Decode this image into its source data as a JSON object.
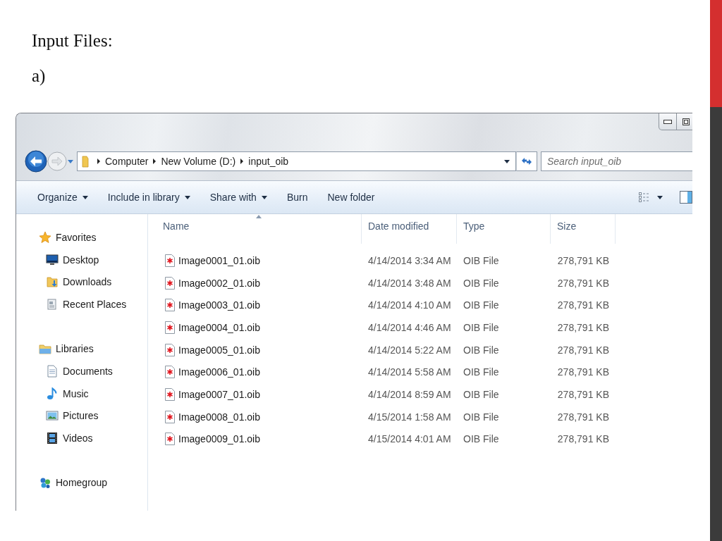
{
  "slide": {
    "heading": "Input Files:",
    "label": "a)"
  },
  "explorer": {
    "address_bar": {
      "breadcrumbs": [
        "Computer",
        "New Volume (D:)",
        "input_oib"
      ]
    },
    "search": {
      "placeholder": "Search input_oib"
    },
    "toolbar": {
      "items": [
        {
          "label": "Organize",
          "dropdown": true
        },
        {
          "label": "Include in library",
          "dropdown": true
        },
        {
          "label": "Share with",
          "dropdown": true
        },
        {
          "label": "Burn",
          "dropdown": false
        },
        {
          "label": "New folder",
          "dropdown": false
        }
      ]
    },
    "navigation": {
      "groups": [
        {
          "label": "Favorites",
          "kind": "star",
          "children": [
            {
              "label": "Desktop",
              "kind": "desktop"
            },
            {
              "label": "Downloads",
              "kind": "downloads"
            },
            {
              "label": "Recent Places",
              "kind": "recent"
            }
          ]
        },
        {
          "label": "Libraries",
          "kind": "library",
          "children": [
            {
              "label": "Documents",
              "kind": "documents"
            },
            {
              "label": "Music",
              "kind": "music"
            },
            {
              "label": "Pictures",
              "kind": "pictures"
            },
            {
              "label": "Videos",
              "kind": "videos"
            }
          ]
        },
        {
          "label": "Homegroup",
          "kind": "homegroup"
        }
      ]
    },
    "table": {
      "columns": [
        {
          "label": "Name",
          "sorted": true
        },
        {
          "label": "Date modified",
          "sorted": false
        },
        {
          "label": "Type",
          "sorted": false
        },
        {
          "label": "Size",
          "sorted": false
        }
      ],
      "rows": [
        [
          "Image0001_01.oib",
          "4/14/2014 3:34 AM",
          "OIB File",
          "278,791 KB"
        ],
        [
          "Image0002_01.oib",
          "4/14/2014 3:48 AM",
          "OIB File",
          "278,791 KB"
        ],
        [
          "Image0003_01.oib",
          "4/14/2014 4:10 AM",
          "OIB File",
          "278,791 KB"
        ],
        [
          "Image0004_01.oib",
          "4/14/2014 4:46 AM",
          "OIB File",
          "278,791 KB"
        ],
        [
          "Image0005_01.oib",
          "4/14/2014 5:22 AM",
          "OIB File",
          "278,791 KB"
        ],
        [
          "Image0006_01.oib",
          "4/14/2014 5:58 AM",
          "OIB File",
          "278,791 KB"
        ],
        [
          "Image0007_01.oib",
          "4/14/2014 8:59 AM",
          "OIB File",
          "278,791 KB"
        ],
        [
          "Image0008_01.oib",
          "4/15/2014 1:58 AM",
          "OIB File",
          "278,791 KB"
        ],
        [
          "Image0009_01.oib",
          "4/15/2014 4:01 AM",
          "OIB File",
          "278,791 KB"
        ]
      ]
    }
  }
}
